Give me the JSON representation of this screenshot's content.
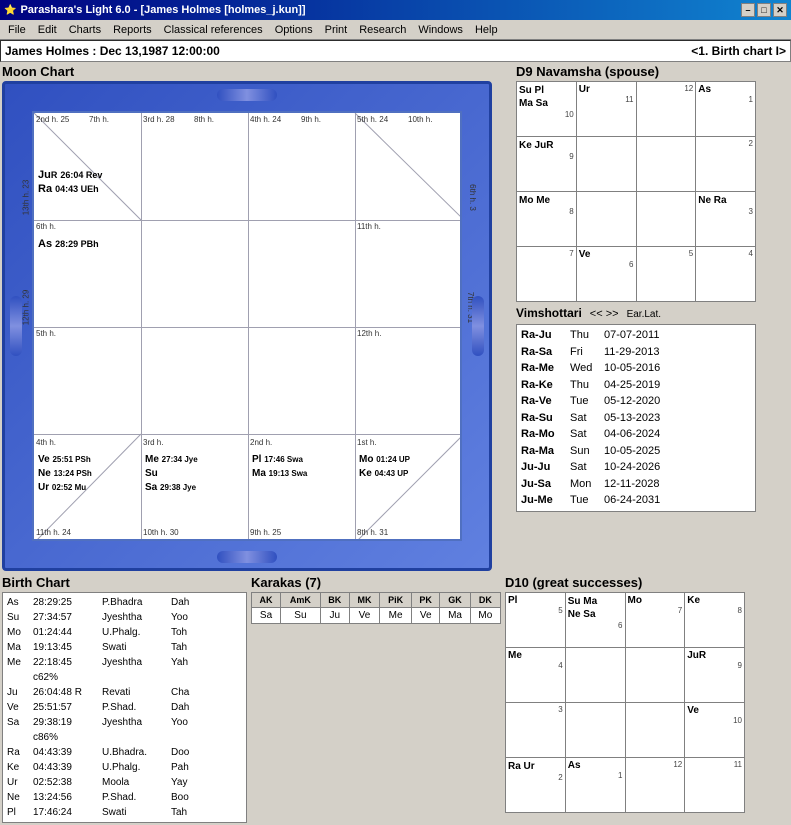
{
  "titleBar": {
    "title": "Parashara's Light 6.0 - [James Holmes  [holmes_j.kun]]",
    "minBtn": "–",
    "maxBtn": "□",
    "closeBtn": "✕"
  },
  "menuBar": {
    "items": [
      "File",
      "Edit",
      "Charts",
      "Reports",
      "Classical references",
      "Options",
      "Print",
      "Research",
      "Windows",
      "Help"
    ]
  },
  "statusBar": {
    "left": "James Holmes :  Dec 13,1987  12:00:00",
    "right": "<1. Birth chart I>"
  },
  "moonChart": {
    "title": "Moon Chart",
    "cells": {
      "r0c0": {
        "label_tl": "2nd h. 25",
        "label_tr": "3rd h. 28",
        "content": ""
      },
      "r0c0_inner": {
        "label": "7th h.",
        "content": ""
      },
      "top_row_labels": [
        "2nd h. 25",
        "3rd h. 28",
        "4th h. 24",
        "5th h. 24"
      ],
      "top_inner_labels": [
        "7th h.",
        "8th h.",
        "9th h.",
        "10th h."
      ],
      "cell_ju_ra": "JuR 26:04 Rev\nRa 04:43 UEh",
      "cell_as": "As 28:29 PBh",
      "cell_ve_ne_ur": "Ve 25:51 PSh\nNe 13:24 PSh\nUr 02:52 Mu",
      "cell_me_su_sa": "Me 27:34 Jye\nSu\nSa 29:38 Jye",
      "cell_pl_ma": "Pl 17:46 Swa\nMa 19:13 Swa",
      "cell_mo_ke": "Mo 01:24 UP\nKe 04:43 UP",
      "bottom_labels": [
        "11th h. 24",
        "10th h. 30",
        "9th h. 25",
        "8th h. 31"
      ],
      "left_labels": [
        "13th h. 23",
        "12th h. 29"
      ],
      "right_labels": [
        "6th h. 3",
        "7th h. 31"
      ],
      "h6_label": "6th h.",
      "h11_label": "11th h.",
      "h12_label": "12th h.",
      "h5_label": "5th h.",
      "h4_label": "4th h.",
      "h3_label": "3rd h.",
      "h2_label": "2nd h.",
      "h1_label": "1st h."
    }
  },
  "d9": {
    "title": "D9 Navamsha  (spouse)",
    "cells": [
      [
        "Su Pl\nMa Sa\n10",
        "Ur\n11",
        "12",
        "As\n1"
      ],
      [
        "Ke JuR\n9",
        "",
        "",
        "2"
      ],
      [
        "Mo Me\n8",
        "",
        "",
        "Ne Ra\n3"
      ],
      [
        "7",
        "Ve\n6",
        "5",
        "4"
      ]
    ]
  },
  "vimshottari": {
    "title": "Vimshottari",
    "nav": "<< >>",
    "label2": "Ear.Lat.",
    "rows": [
      {
        "label": "Ra-Ju",
        "day": "Thu",
        "date": "07-07-2011"
      },
      {
        "label": "Ra-Sa",
        "day": "Fri",
        "date": "11-29-2013"
      },
      {
        "label": "Ra-Me",
        "day": "Wed",
        "date": "10-05-2016"
      },
      {
        "label": "Ra-Ke",
        "day": "Thu",
        "date": "04-25-2019"
      },
      {
        "label": "Ra-Ve",
        "day": "Tue",
        "date": "05-12-2020"
      },
      {
        "label": "Ra-Su",
        "day": "Sat",
        "date": "05-13-2023"
      },
      {
        "label": "Ra-Mo",
        "day": "Sat",
        "date": "04-06-2024"
      },
      {
        "label": "Ra-Ma",
        "day": "Sun",
        "date": "10-05-2025"
      },
      {
        "label": "Ju-Ju",
        "day": "Sat",
        "date": "10-24-2026"
      },
      {
        "label": "Ju-Sa",
        "day": "Mon",
        "date": "12-11-2028"
      },
      {
        "label": "Ju-Me",
        "day": "Tue",
        "date": "06-24-2031"
      }
    ]
  },
  "birthChart": {
    "title": "Birth Chart",
    "rows": [
      {
        "planet": "As",
        "deg": "28:29:25",
        "naksh": "P.Bhadra",
        "sign": "Dah"
      },
      {
        "planet": "Su",
        "deg": "27:34:57",
        "naksh": "Jyeshtha",
        "sign": "Yoo"
      },
      {
        "planet": "Mo",
        "deg": "01:24:44",
        "naksh": "U.Phalg.",
        "sign": "Toh"
      },
      {
        "planet": "Ma",
        "deg": "19:13:45",
        "naksh": "Swati",
        "sign": "Tah"
      },
      {
        "planet": "Me",
        "deg": "22:18:45 c62%",
        "naksh": "Jyeshtha",
        "sign": "Yah"
      },
      {
        "planet": "Ju",
        "deg": "26:04:48 R",
        "naksh": "Revati",
        "sign": "Cha"
      },
      {
        "planet": "Ve",
        "deg": "25:51:57",
        "naksh": "P.Shad.",
        "sign": "Dah"
      },
      {
        "planet": "Sa",
        "deg": "29:38:19 c86%",
        "naksh": "Jyeshtha",
        "sign": "Yoo"
      },
      {
        "planet": "Ra",
        "deg": "04:43:39",
        "naksh": "U.Bhadra.",
        "sign": "Doo"
      },
      {
        "planet": "Ke",
        "deg": "04:43:39",
        "naksh": "U.Phalg.",
        "sign": "Pah"
      },
      {
        "planet": "Ur",
        "deg": "02:52:38",
        "naksh": "Moola",
        "sign": "Yay"
      },
      {
        "planet": "Ne",
        "deg": "13:24:56",
        "naksh": "P.Shad.",
        "sign": "Boo"
      },
      {
        "planet": "Pl",
        "deg": "17:46:24",
        "naksh": "Swati",
        "sign": "Tah"
      }
    ]
  },
  "karakas": {
    "title": "Karakas (7)",
    "headers": [
      "AK",
      "AmK",
      "BK",
      "MK",
      "PiK",
      "PK",
      "GK",
      "DK"
    ],
    "values": [
      "Sa",
      "Su",
      "Ju",
      "Ve",
      "Me",
      "Ve",
      "Ma",
      "Mo"
    ]
  },
  "d10": {
    "title": "D10  (great successes)",
    "cells": [
      [
        "Pl\n5",
        "Su Ma\nNe Sa\n6",
        "Mo\n7",
        "Ke\n8"
      ],
      [
        "Me\n4",
        "",
        "",
        "JuR\n9"
      ],
      [
        "3",
        "",
        "",
        "Ve\n10"
      ],
      [
        "Ra Ur\n2",
        "As\n1",
        "12",
        "11"
      ]
    ]
  }
}
